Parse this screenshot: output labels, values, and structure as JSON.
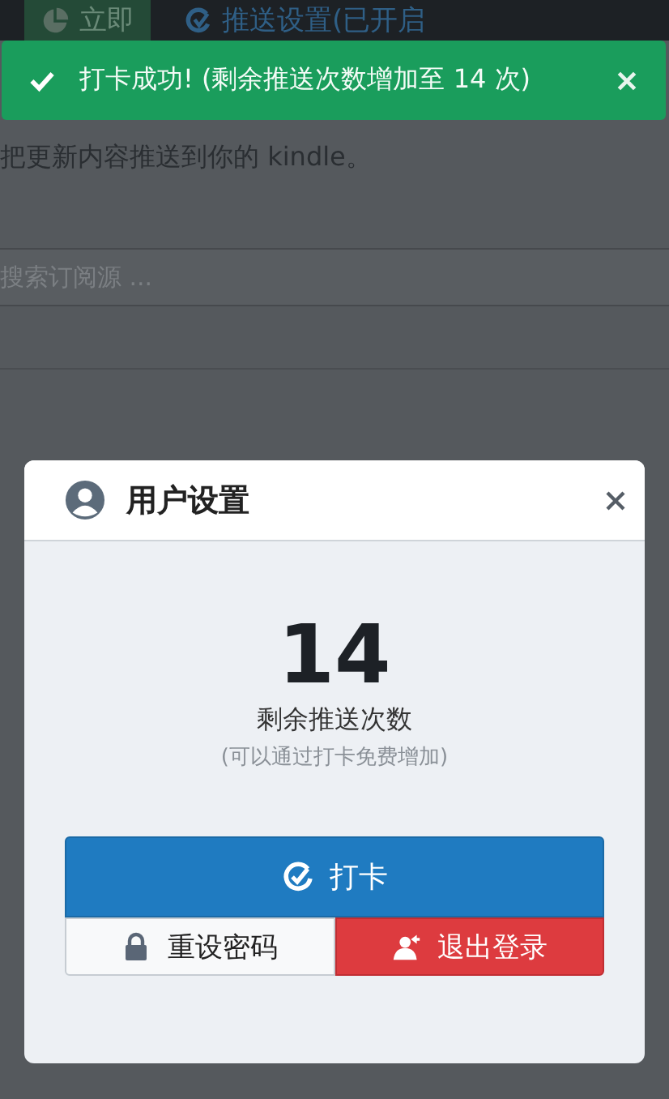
{
  "nav": {
    "items": [
      {
        "label": "立即",
        "kind": "action",
        "selected": true
      },
      {
        "label": "推送设置(已开启",
        "kind": "settings",
        "selected": false
      }
    ]
  },
  "toast": {
    "message": "打卡成功! (剩余推送次数增加至 14 次)"
  },
  "intro": "把更新内容推送到你的 kindle。",
  "search": {
    "placeholder": "搜索订阅源 ..."
  },
  "dialog": {
    "title": "用户设置",
    "count": "14",
    "count_label": "剩余推送次数",
    "hint": "(可以通过打卡免费增加)",
    "buttons": [
      {
        "label": "打卡",
        "kind": "checkin"
      },
      {
        "label": "重设密码",
        "kind": "reset"
      },
      {
        "label": "退出登录",
        "kind": "logout"
      }
    ]
  }
}
